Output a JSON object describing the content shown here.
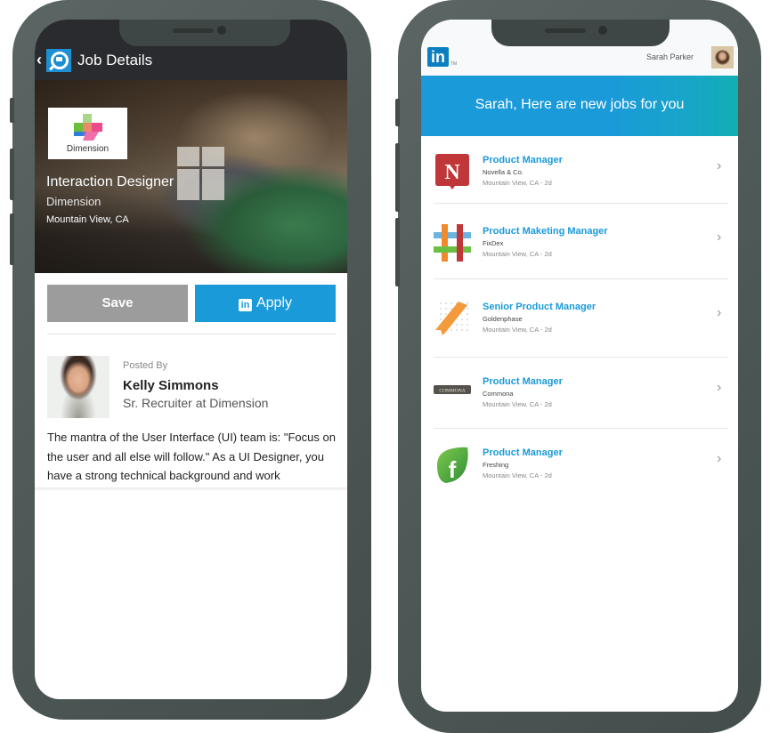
{
  "left_phone": {
    "header": {
      "back_icon": "chevron-left",
      "app_icon": "job-search-icon",
      "title": "Job Details"
    },
    "job": {
      "company_logo_text": "Dimension",
      "title": "Interaction Designer",
      "company": "Dimension",
      "location": "Mountain View, CA"
    },
    "actions": {
      "save_label": "Save",
      "apply_label": "Apply",
      "apply_icon_text": "in"
    },
    "poster": {
      "posted_by_label": "Posted By",
      "name": "Kelly Simmons",
      "role": "Sr. Recruiter at Dimension"
    },
    "description": "The mantra of the User Interface (UI) team is: \"Focus on the user and all else will follow.\" As a UI Designer, you have a strong technical background and work"
  },
  "right_phone": {
    "topbar": {
      "logo_text": "in",
      "trademark": "TM",
      "user_name": "Sarah Parker"
    },
    "banner": {
      "text": "Sarah, Here are new jobs for you"
    },
    "jobs": [
      {
        "title": "Product Manager",
        "company": "Novella & Co.",
        "location": "Mountain View, CA - 2d",
        "logo": "novella-logo"
      },
      {
        "title": "Product Maketing Manager",
        "company": "FixDex",
        "location": "Mountain View, CA - 2d",
        "logo": "fixdex-logo"
      },
      {
        "title": "Senior Product Manager",
        "company": "Goldenphase",
        "location": "Mountain View, CA - 2d",
        "logo": "goldenphase-logo"
      },
      {
        "title": "Product Manager",
        "company": "Commona",
        "location": "Mountain View, CA - 2d",
        "logo": "commona-logo",
        "logo_text": "COMMONA"
      },
      {
        "title": "Product Manager",
        "company": "Freshing",
        "location": "Mountain View, CA - 2d",
        "logo": "freshing-logo",
        "logo_text": "f"
      }
    ],
    "chevron": "›"
  },
  "colors": {
    "accent": "#1a9ad9",
    "linkedin_blue": "#0b7fc0",
    "header_dark": "#2a2b2f",
    "save_gray": "#9c9c9c",
    "phone_frame": "#4f5957"
  }
}
